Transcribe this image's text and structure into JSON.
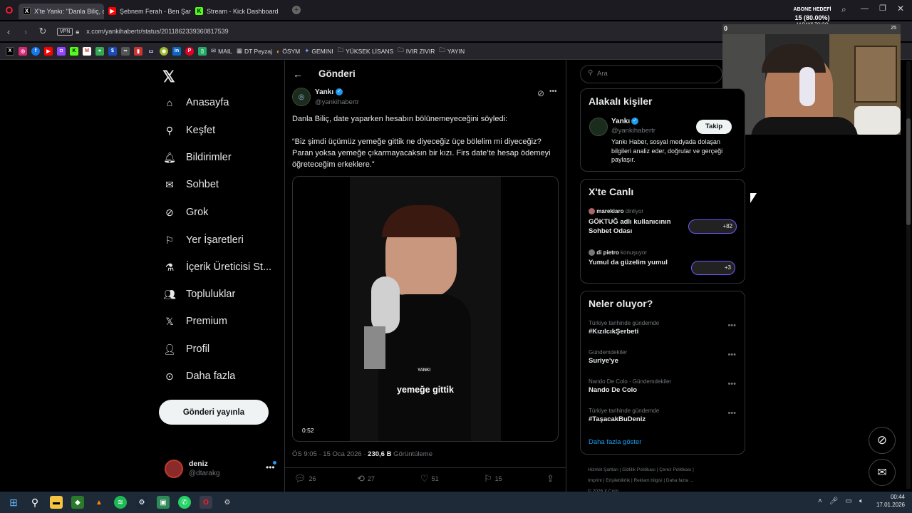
{
  "browser": {
    "tabs": [
      {
        "label": "X'te Yankı: \"Danla Biliç, da",
        "icon": "x-icon"
      },
      {
        "label": "Şebnem Ferah - Ben Şarkı",
        "icon": "youtube-icon"
      },
      {
        "label": "Stream - Kick Dashboard",
        "icon": "kick-icon"
      }
    ],
    "url": "x.com/yankihabertr/status/2011862339360817539",
    "vpn_label": "VPN",
    "bookmarks": [
      "MAIL",
      "DT Peyzaj",
      "ÖSYM",
      "GEMINI",
      "YÜKSEK LİSANS",
      "IVIR ZIVIR",
      "YAYIN"
    ]
  },
  "overlay": {
    "goal_label": "ABONE HEDEFİ",
    "goal_value": "15 (80.00%)",
    "days_label": "14 DAYS TO GO",
    "counter_left": "0",
    "counter_right": "25"
  },
  "nav": {
    "items": [
      {
        "label": "Anasayfa",
        "icon": "home-icon"
      },
      {
        "label": "Keşfet",
        "icon": "search-icon"
      },
      {
        "label": "Bildirimler",
        "icon": "bell-icon"
      },
      {
        "label": "Sohbet",
        "icon": "mail-icon"
      },
      {
        "label": "Grok",
        "icon": "grok-icon"
      },
      {
        "label": "Yer İşaretleri",
        "icon": "bookmark-icon"
      },
      {
        "label": "İçerik Üreticisi St...",
        "icon": "flask-icon"
      },
      {
        "label": "Topluluklar",
        "icon": "people-icon"
      },
      {
        "label": "Premium",
        "icon": "x-icon"
      },
      {
        "label": "Profil",
        "icon": "person-icon"
      },
      {
        "label": "Daha fazla",
        "icon": "more-circle-icon"
      }
    ],
    "post_button": "Gönderi yayınla",
    "account": {
      "name": "deniz",
      "handle": "@dtarakg"
    }
  },
  "post": {
    "header": "Gönderi",
    "author_name": "Yankı",
    "author_handle": "@yankihabertr",
    "text_intro": "Danla Biliç, date yaparken hesabın bölünemeyeceğini söyledi:",
    "text_quote": "“Biz şimdi üçümüz yemeğe gittik ne diyeceğiz üçe bölelim mi diyeceğiz? Paran yoksa yemeğe çıkarmayacaksın bir kızı. Firs date’te hesap ödemeyi öğreteceğim erkeklere.”",
    "video_caption": "yemeğe gittik",
    "video_watermark": "YANKI",
    "video_time": "0:52",
    "meta_time": "ÖS 9:05 · 15 Oca 2026 · ",
    "meta_views": "230,6 B",
    "meta_views_label": " Görüntüleme",
    "replies": "26",
    "reposts": "27",
    "likes": "51",
    "bookmarks": "15"
  },
  "right": {
    "search_placeholder": "Ara",
    "related_title": "Alakalı kişiler",
    "related_name": "Yankı",
    "related_handle": "@yankihabertr",
    "related_follow": "Takip",
    "related_bio": "Yankı Haber, sosyal medyada dolaşan bilgileri analiz eder, doğrular ve gerçeği paylaşır.",
    "live_title": "X'te Canlı",
    "spaces": [
      {
        "host": "marekiaro",
        "status": "dinliyor",
        "title": "GÖKTUĞ adlı kullanıcının Sohbet Odası",
        "count": "+82"
      },
      {
        "host": "di pietro",
        "status": "konuşuyor",
        "title": "Yumul da güzelim yumul",
        "count": "+3"
      }
    ],
    "trends_title": "Neler oluyor?",
    "trends": [
      {
        "context": "Türkiye tarihinde gündemde",
        "name": "#KızılcıkŞerbeti"
      },
      {
        "context": "Gündemdekiler",
        "name": "Suriye'ye"
      },
      {
        "context": "Nando De Colo · Gündemdekiler",
        "name": "Nando De Colo"
      },
      {
        "context": "Türkiye tarihinde gündemde",
        "name": "#TaşacakBuDeniz"
      }
    ],
    "show_more": "Daha fazla göster",
    "footer_links": [
      "Hizmet Şartları",
      "Gizlilik Politikası",
      "Çerez Politikası",
      "Imprint",
      "Erişilebilirlik",
      "Reklam bilgisi",
      "Daha fazla ..."
    ],
    "copyright": "© 2026 X Corp."
  },
  "taskbar": {
    "time": "00:44",
    "date": "17.01.2026"
  },
  "colors": {
    "accent": "#1d9bf0",
    "background": "#000000",
    "border": "#2f3336",
    "muted": "#71767b"
  }
}
